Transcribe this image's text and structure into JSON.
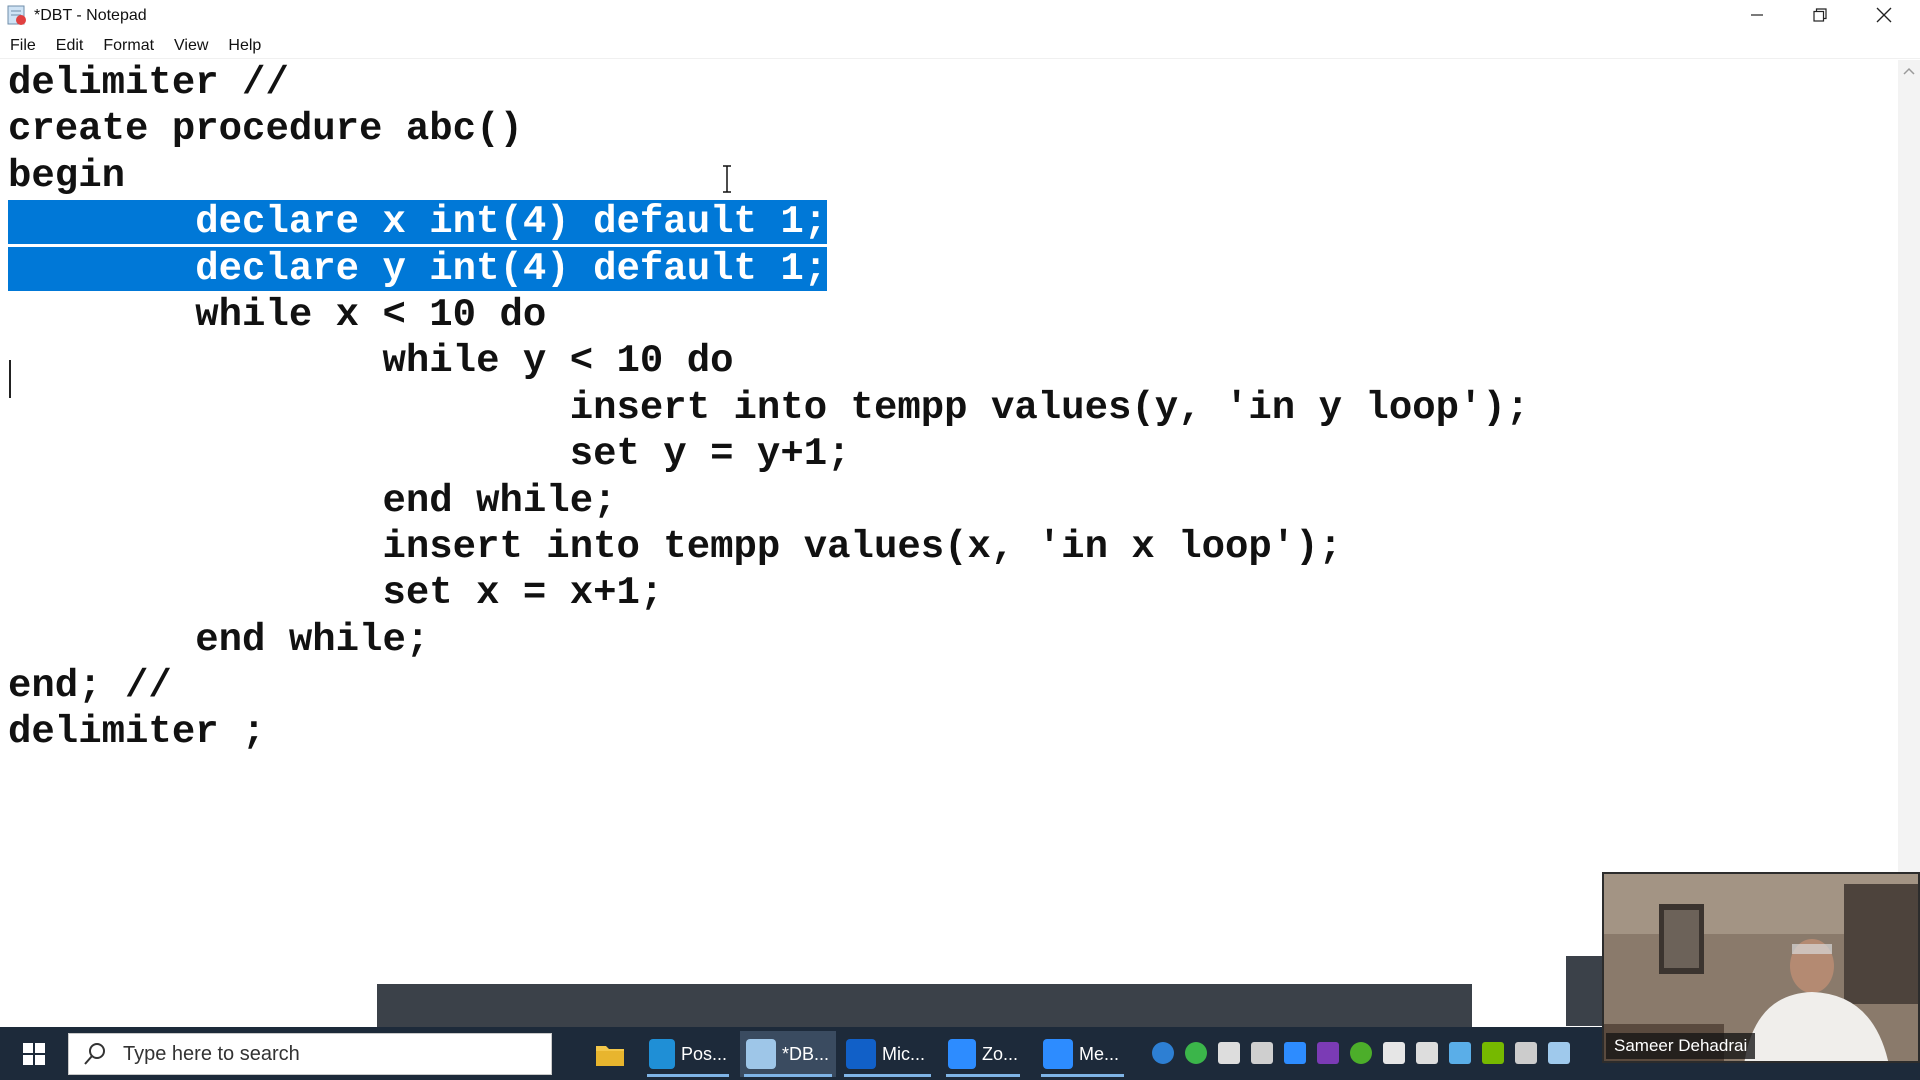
{
  "window": {
    "title": "*DBT - Notepad"
  },
  "menu": {
    "items": [
      "File",
      "Edit",
      "Format",
      "View",
      "Help"
    ]
  },
  "editor": {
    "lines": [
      "delimiter //",
      "create procedure abc()",
      "begin",
      "        declare x int(4) default 1;",
      "        declare y int(4) default 1;",
      "        while x < 10 do",
      "                while y < 10 do",
      "                        insert into tempp values(y, 'in y loop');",
      "                        set y = y+1;",
      "                end while;",
      "                insert into tempp values(x, 'in x loop');",
      "                set x = x+1;",
      "        end while;",
      "end; //",
      "delimiter ;"
    ],
    "selected_lines": [
      3,
      4
    ],
    "selection_color": "#0078d7"
  },
  "taskbar": {
    "search_placeholder": "Type here to search",
    "apps": [
      {
        "label": "Pos...",
        "icon": "edge-icon",
        "color": "#1f8fd6"
      },
      {
        "label": "*DB...",
        "icon": "notepad-icon",
        "color": "#9ec6e8"
      },
      {
        "label": "Mic...",
        "icon": "whiteboard-icon",
        "color": "#1160c8"
      },
      {
        "label": "Zo...",
        "icon": "zoom-icon",
        "color": "#2d8cff"
      },
      {
        "label": "Me...",
        "icon": "zoom-meeting-icon",
        "color": "#2d8cff"
      }
    ],
    "tray_icons": [
      "help-icon",
      "check-icon",
      "microphone-icon",
      "folder-icon",
      "zoom-tray-icon",
      "onenote-icon",
      "evernote-icon",
      "security-icon",
      "wifi-icon",
      "bluetooth-icon",
      "nvidia-icon",
      "tablet-icon",
      "pen-icon"
    ]
  },
  "webcam": {
    "participant_name": "Sameer Dehadrai"
  }
}
